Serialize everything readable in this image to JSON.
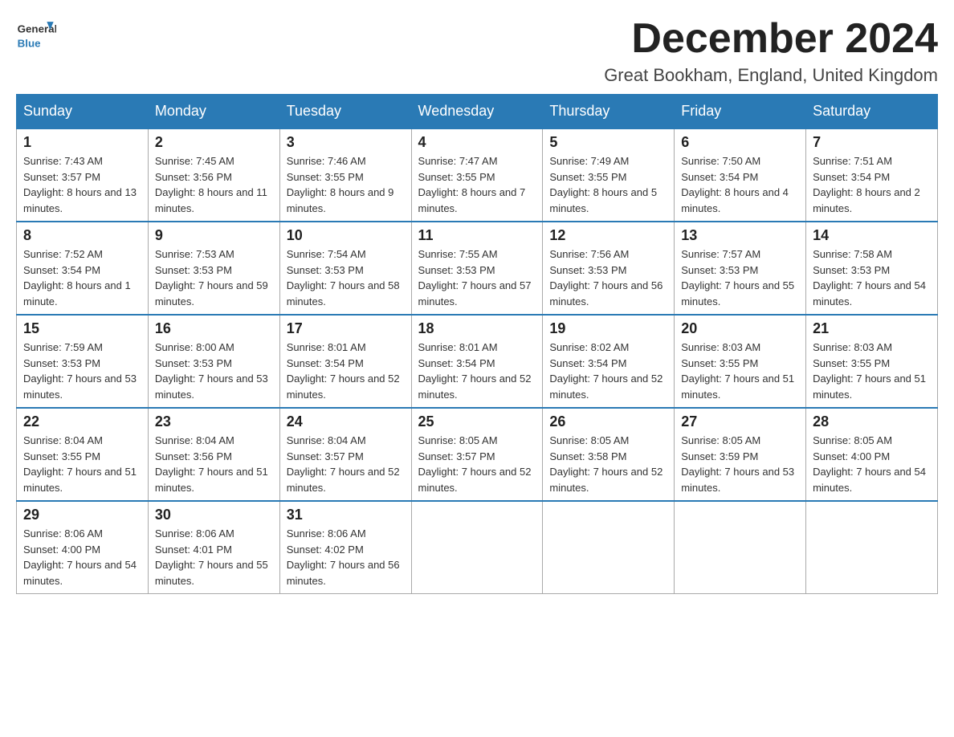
{
  "header": {
    "logo_general": "General",
    "logo_blue": "Blue",
    "month_title": "December 2024",
    "location": "Great Bookham, England, United Kingdom"
  },
  "days_of_week": [
    "Sunday",
    "Monday",
    "Tuesday",
    "Wednesday",
    "Thursday",
    "Friday",
    "Saturday"
  ],
  "weeks": [
    [
      {
        "day": "1",
        "sunrise": "Sunrise: 7:43 AM",
        "sunset": "Sunset: 3:57 PM",
        "daylight": "Daylight: 8 hours and 13 minutes."
      },
      {
        "day": "2",
        "sunrise": "Sunrise: 7:45 AM",
        "sunset": "Sunset: 3:56 PM",
        "daylight": "Daylight: 8 hours and 11 minutes."
      },
      {
        "day": "3",
        "sunrise": "Sunrise: 7:46 AM",
        "sunset": "Sunset: 3:55 PM",
        "daylight": "Daylight: 8 hours and 9 minutes."
      },
      {
        "day": "4",
        "sunrise": "Sunrise: 7:47 AM",
        "sunset": "Sunset: 3:55 PM",
        "daylight": "Daylight: 8 hours and 7 minutes."
      },
      {
        "day": "5",
        "sunrise": "Sunrise: 7:49 AM",
        "sunset": "Sunset: 3:55 PM",
        "daylight": "Daylight: 8 hours and 5 minutes."
      },
      {
        "day": "6",
        "sunrise": "Sunrise: 7:50 AM",
        "sunset": "Sunset: 3:54 PM",
        "daylight": "Daylight: 8 hours and 4 minutes."
      },
      {
        "day": "7",
        "sunrise": "Sunrise: 7:51 AM",
        "sunset": "Sunset: 3:54 PM",
        "daylight": "Daylight: 8 hours and 2 minutes."
      }
    ],
    [
      {
        "day": "8",
        "sunrise": "Sunrise: 7:52 AM",
        "sunset": "Sunset: 3:54 PM",
        "daylight": "Daylight: 8 hours and 1 minute."
      },
      {
        "day": "9",
        "sunrise": "Sunrise: 7:53 AM",
        "sunset": "Sunset: 3:53 PM",
        "daylight": "Daylight: 7 hours and 59 minutes."
      },
      {
        "day": "10",
        "sunrise": "Sunrise: 7:54 AM",
        "sunset": "Sunset: 3:53 PM",
        "daylight": "Daylight: 7 hours and 58 minutes."
      },
      {
        "day": "11",
        "sunrise": "Sunrise: 7:55 AM",
        "sunset": "Sunset: 3:53 PM",
        "daylight": "Daylight: 7 hours and 57 minutes."
      },
      {
        "day": "12",
        "sunrise": "Sunrise: 7:56 AM",
        "sunset": "Sunset: 3:53 PM",
        "daylight": "Daylight: 7 hours and 56 minutes."
      },
      {
        "day": "13",
        "sunrise": "Sunrise: 7:57 AM",
        "sunset": "Sunset: 3:53 PM",
        "daylight": "Daylight: 7 hours and 55 minutes."
      },
      {
        "day": "14",
        "sunrise": "Sunrise: 7:58 AM",
        "sunset": "Sunset: 3:53 PM",
        "daylight": "Daylight: 7 hours and 54 minutes."
      }
    ],
    [
      {
        "day": "15",
        "sunrise": "Sunrise: 7:59 AM",
        "sunset": "Sunset: 3:53 PM",
        "daylight": "Daylight: 7 hours and 53 minutes."
      },
      {
        "day": "16",
        "sunrise": "Sunrise: 8:00 AM",
        "sunset": "Sunset: 3:53 PM",
        "daylight": "Daylight: 7 hours and 53 minutes."
      },
      {
        "day": "17",
        "sunrise": "Sunrise: 8:01 AM",
        "sunset": "Sunset: 3:54 PM",
        "daylight": "Daylight: 7 hours and 52 minutes."
      },
      {
        "day": "18",
        "sunrise": "Sunrise: 8:01 AM",
        "sunset": "Sunset: 3:54 PM",
        "daylight": "Daylight: 7 hours and 52 minutes."
      },
      {
        "day": "19",
        "sunrise": "Sunrise: 8:02 AM",
        "sunset": "Sunset: 3:54 PM",
        "daylight": "Daylight: 7 hours and 52 minutes."
      },
      {
        "day": "20",
        "sunrise": "Sunrise: 8:03 AM",
        "sunset": "Sunset: 3:55 PM",
        "daylight": "Daylight: 7 hours and 51 minutes."
      },
      {
        "day": "21",
        "sunrise": "Sunrise: 8:03 AM",
        "sunset": "Sunset: 3:55 PM",
        "daylight": "Daylight: 7 hours and 51 minutes."
      }
    ],
    [
      {
        "day": "22",
        "sunrise": "Sunrise: 8:04 AM",
        "sunset": "Sunset: 3:55 PM",
        "daylight": "Daylight: 7 hours and 51 minutes."
      },
      {
        "day": "23",
        "sunrise": "Sunrise: 8:04 AM",
        "sunset": "Sunset: 3:56 PM",
        "daylight": "Daylight: 7 hours and 51 minutes."
      },
      {
        "day": "24",
        "sunrise": "Sunrise: 8:04 AM",
        "sunset": "Sunset: 3:57 PM",
        "daylight": "Daylight: 7 hours and 52 minutes."
      },
      {
        "day": "25",
        "sunrise": "Sunrise: 8:05 AM",
        "sunset": "Sunset: 3:57 PM",
        "daylight": "Daylight: 7 hours and 52 minutes."
      },
      {
        "day": "26",
        "sunrise": "Sunrise: 8:05 AM",
        "sunset": "Sunset: 3:58 PM",
        "daylight": "Daylight: 7 hours and 52 minutes."
      },
      {
        "day": "27",
        "sunrise": "Sunrise: 8:05 AM",
        "sunset": "Sunset: 3:59 PM",
        "daylight": "Daylight: 7 hours and 53 minutes."
      },
      {
        "day": "28",
        "sunrise": "Sunrise: 8:05 AM",
        "sunset": "Sunset: 4:00 PM",
        "daylight": "Daylight: 7 hours and 54 minutes."
      }
    ],
    [
      {
        "day": "29",
        "sunrise": "Sunrise: 8:06 AM",
        "sunset": "Sunset: 4:00 PM",
        "daylight": "Daylight: 7 hours and 54 minutes."
      },
      {
        "day": "30",
        "sunrise": "Sunrise: 8:06 AM",
        "sunset": "Sunset: 4:01 PM",
        "daylight": "Daylight: 7 hours and 55 minutes."
      },
      {
        "day": "31",
        "sunrise": "Sunrise: 8:06 AM",
        "sunset": "Sunset: 4:02 PM",
        "daylight": "Daylight: 7 hours and 56 minutes."
      },
      null,
      null,
      null,
      null
    ]
  ]
}
